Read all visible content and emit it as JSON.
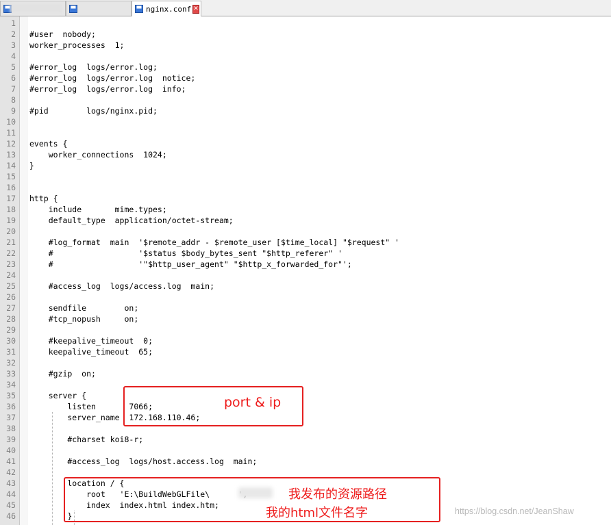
{
  "tabs": [
    {
      "label": "",
      "active": false
    },
    {
      "label": "",
      "active": false
    },
    {
      "label": "nginx.conf",
      "active": true
    }
  ],
  "editor": {
    "lines": [
      {
        "n": "1",
        "t": ""
      },
      {
        "n": "2",
        "t": "#user  nobody;"
      },
      {
        "n": "3",
        "t": "worker_processes  1;"
      },
      {
        "n": "4",
        "t": ""
      },
      {
        "n": "5",
        "t": "#error_log  logs/error.log;"
      },
      {
        "n": "6",
        "t": "#error_log  logs/error.log  notice;"
      },
      {
        "n": "7",
        "t": "#error_log  logs/error.log  info;"
      },
      {
        "n": "8",
        "t": ""
      },
      {
        "n": "9",
        "t": "#pid        logs/nginx.pid;"
      },
      {
        "n": "10",
        "t": ""
      },
      {
        "n": "11",
        "t": ""
      },
      {
        "n": "12",
        "t": "events {"
      },
      {
        "n": "13",
        "t": "    worker_connections  1024;"
      },
      {
        "n": "14",
        "t": "}"
      },
      {
        "n": "15",
        "t": ""
      },
      {
        "n": "16",
        "t": ""
      },
      {
        "n": "17",
        "t": "http {"
      },
      {
        "n": "18",
        "t": "    include       mime.types;"
      },
      {
        "n": "19",
        "t": "    default_type  application/octet-stream;"
      },
      {
        "n": "20",
        "t": ""
      },
      {
        "n": "21",
        "t": "    #log_format  main  '$remote_addr - $remote_user [$time_local] \"$request\" '"
      },
      {
        "n": "22",
        "t": "    #                  '$status $body_bytes_sent \"$http_referer\" '"
      },
      {
        "n": "23",
        "t": "    #                  '\"$http_user_agent\" \"$http_x_forwarded_for\"';"
      },
      {
        "n": "24",
        "t": ""
      },
      {
        "n": "25",
        "t": "    #access_log  logs/access.log  main;"
      },
      {
        "n": "26",
        "t": ""
      },
      {
        "n": "27",
        "t": "    sendfile        on;"
      },
      {
        "n": "28",
        "t": "    #tcp_nopush     on;"
      },
      {
        "n": "29",
        "t": ""
      },
      {
        "n": "30",
        "t": "    #keepalive_timeout  0;"
      },
      {
        "n": "31",
        "t": "    keepalive_timeout  65;"
      },
      {
        "n": "32",
        "t": ""
      },
      {
        "n": "33",
        "t": "    #gzip  on;"
      },
      {
        "n": "34",
        "t": ""
      },
      {
        "n": "35",
        "t": "    server {"
      },
      {
        "n": "36",
        "t": "        listen       7066;"
      },
      {
        "n": "37",
        "t": "        server_name  172.168.110.46;"
      },
      {
        "n": "38",
        "t": ""
      },
      {
        "n": "39",
        "t": "        #charset koi8-r;"
      },
      {
        "n": "40",
        "t": ""
      },
      {
        "n": "41",
        "t": "        #access_log  logs/host.access.log  main;"
      },
      {
        "n": "42",
        "t": ""
      },
      {
        "n": "43",
        "t": "        location / {"
      },
      {
        "n": "44",
        "t": "            root   'E:\\BuildWebGLFile\\      ';"
      },
      {
        "n": "45",
        "t": "            index  index.html index.htm;"
      },
      {
        "n": "46",
        "t": "        }"
      }
    ]
  },
  "annotations": {
    "port_ip": "port  &  ip",
    "resource_path": "我发布的资源路径",
    "html_filename": "我的html文件名字"
  },
  "watermark": "https://blog.csdn.net/JeanShaw",
  "colors": {
    "annotation": "#e52020",
    "line_number": "#808080",
    "gutter": "#e4e4e4"
  }
}
